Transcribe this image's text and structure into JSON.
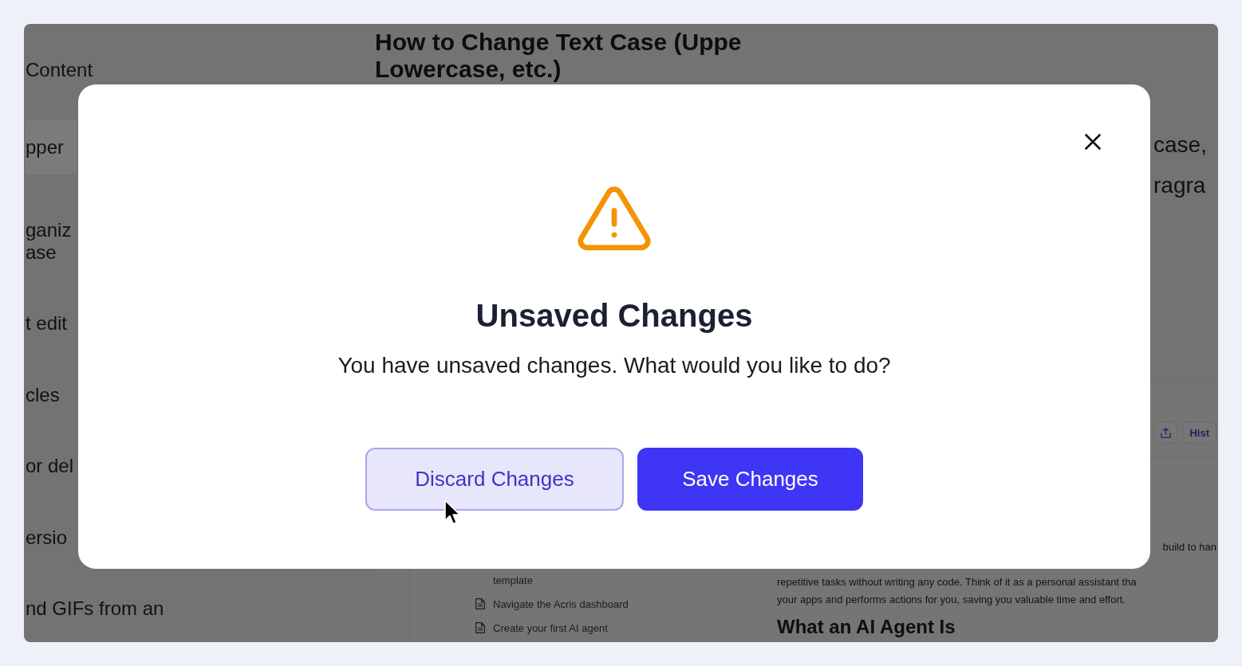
{
  "toc": {
    "title": "Content",
    "items": [
      {
        "lines": [
          "pper"
        ],
        "selected": true
      },
      {
        "lines": [
          "ganiz",
          "ase"
        ],
        "selected": false
      },
      {
        "lines": [
          "t edit"
        ],
        "selected": false
      },
      {
        "lines": [
          "cles"
        ],
        "selected": false
      },
      {
        "lines": [
          "or del"
        ],
        "selected": false
      },
      {
        "lines": [
          "ersio"
        ],
        "selected": false
      },
      {
        "lines": [
          "nd GIFs from an"
        ],
        "selected": false
      }
    ]
  },
  "article": {
    "heading_lines": [
      "How to Change Text Case (Uppe",
      "Lowercase, etc.)"
    ],
    "intro_lines": [
      "case,",
      "ragra"
    ],
    "app_screenshot": {
      "toolbar": {
        "history_button": "Hist"
      },
      "lessons": [
        {
          "kind": "continuation",
          "label": "template"
        },
        {
          "kind": "page",
          "label": "Navigate the Acris dashboard"
        },
        {
          "kind": "page",
          "label": "Create your first AI agent"
        }
      ],
      "content": {
        "line_end": "build to han",
        "lines": [
          "repetitive tasks without writing any code. Think of it as a personal assistant tha",
          "your apps and performs actions for you, saving you valuable time and effort."
        ],
        "heading": "What an AI Agent Is"
      }
    }
  },
  "dialog": {
    "title": "Unsaved Changes",
    "message": "You have unsaved changes. What would you like to do?",
    "buttons": [
      {
        "label": "Discard Changes",
        "kind": "secondary"
      },
      {
        "label": "Save Changes",
        "kind": "primary"
      }
    ]
  }
}
